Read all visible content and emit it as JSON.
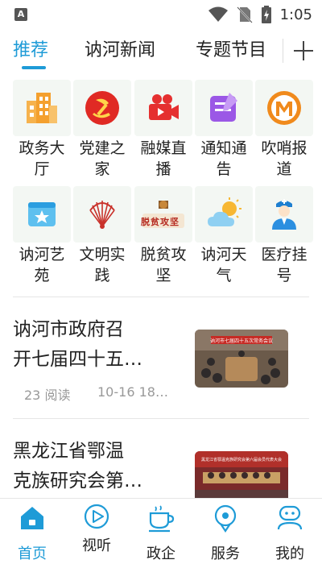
{
  "status_bar": {
    "app_badge": "A",
    "time": "1:05"
  },
  "tabs": [
    {
      "label": "推荐",
      "active": true
    },
    {
      "label": "讷河新闻",
      "active": false
    },
    {
      "label": "专题节目",
      "active": false
    }
  ],
  "tab_add_icon": "plus-icon",
  "grid": [
    {
      "label_line1": "政务大",
      "label_line2": "厅",
      "icon": "building-icon"
    },
    {
      "label_line1": "党建之",
      "label_line2": "家",
      "icon": "party-emblem-icon"
    },
    {
      "label_line1": "融媒直",
      "label_line2": "播",
      "icon": "video-camera-icon"
    },
    {
      "label_line1": "通知通",
      "label_line2": "告",
      "icon": "notice-edit-icon"
    },
    {
      "label_line1": "吹哨报",
      "label_line2": "道",
      "icon": "whistle-report-icon"
    },
    {
      "label_line1": "讷河艺",
      "label_line2": "苑",
      "icon": "art-calendar-icon"
    },
    {
      "label_line1": "文明实",
      "label_line2": "践",
      "icon": "civilization-fan-icon"
    },
    {
      "label_line1": "脱贫攻",
      "label_line2": "坚",
      "icon": "poverty-alleviation-icon",
      "icon_text": "脱贫攻坚"
    },
    {
      "label_line1": "讷河天",
      "label_line2": "气",
      "icon": "weather-icon"
    },
    {
      "label_line1": "医疗挂",
      "label_line2": "号",
      "icon": "doctor-icon"
    }
  ],
  "news": [
    {
      "title_line1": "讷河市政府召",
      "title_line2": "开七届四十五…",
      "reads": "23 阅读",
      "date": "10-16 18…",
      "banner_text": "讷河市七届四十五次常务会议"
    },
    {
      "title_line1": "黑龙江省鄂温",
      "title_line2": "克族研究会第…",
      "banner_text": "黑龙江省鄂温克族研究会第六届会员代表大会"
    }
  ],
  "bottom_nav": [
    {
      "label": "首页",
      "icon": "home-icon",
      "active": true
    },
    {
      "label": "视听",
      "icon": "play-circle-icon",
      "active": false
    },
    {
      "label": "政企",
      "icon": "coffee-cup-icon",
      "active": false
    },
    {
      "label": "服务",
      "icon": "service-location-icon",
      "active": false
    },
    {
      "label": "我的",
      "icon": "robot-profile-icon",
      "active": false
    }
  ],
  "colors": {
    "accent": "#1e9bd7",
    "text": "#222222",
    "muted": "#999999"
  }
}
